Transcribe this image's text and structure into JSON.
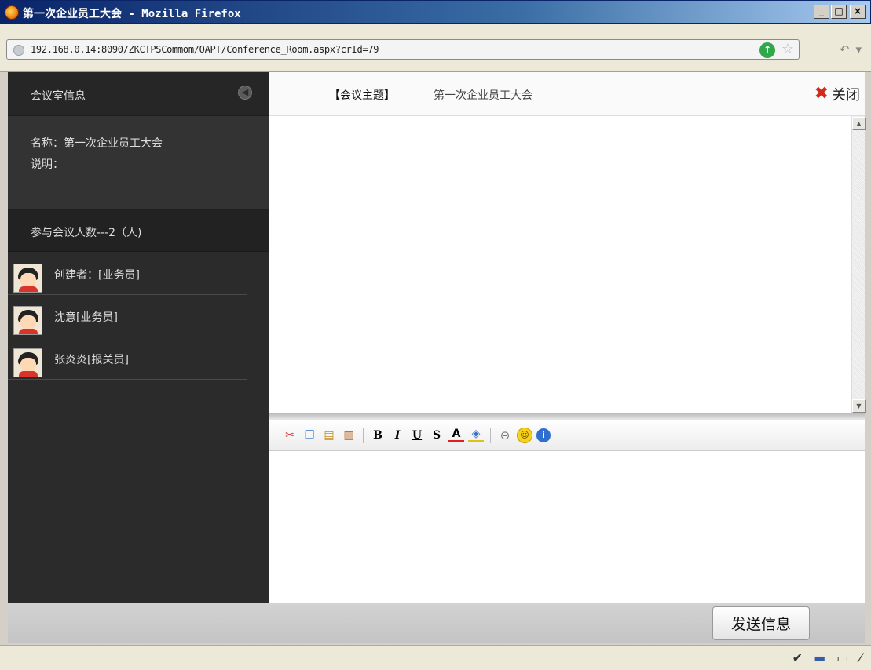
{
  "window": {
    "title": "第一次企业员工大会 - Mozilla Firefox",
    "controls": {
      "minimize": "_",
      "maximize": "□",
      "close": "×"
    }
  },
  "browser": {
    "url": "192.168.0.14:8090/ZKCTPSCommom/OAPT/Conference_Room.aspx?crId=79"
  },
  "sidebar": {
    "title": "会议室信息",
    "name_line": "名称：第一次企业员工大会",
    "desc_line": "说明：",
    "participants_line": "参与会议人数---2（人)",
    "members": [
      {
        "label": "创建者：[业务员]"
      },
      {
        "label": "沈意[业务员]"
      },
      {
        "label": "张炎炎[报关员]"
      }
    ]
  },
  "topic": {
    "label": "【会议主题】",
    "value": "第一次企业员工大会",
    "close_label": "关闭"
  },
  "toolbar": {
    "buttons": [
      "cut",
      "copy",
      "paste",
      "paste-text",
      "bold",
      "italic",
      "underline",
      "strikethrough",
      "font-color",
      "background-color",
      "link",
      "emoticon",
      "info"
    ]
  },
  "footer": {
    "send_label": "发送信息"
  },
  "colors": {
    "sidebar_bg": "#2b2b2b",
    "accent_close": "#d42a1c"
  }
}
